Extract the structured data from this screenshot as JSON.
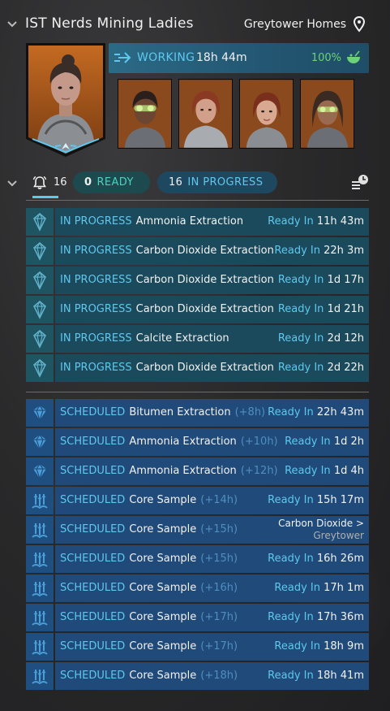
{
  "header": {
    "crew_name": "IST Nerds Mining Ladies",
    "location": "Greytower Homes"
  },
  "status": {
    "state": "WORKING",
    "time": "18h 44m",
    "food": "100%"
  },
  "filters": {
    "alerts": "16",
    "ready_count": "0",
    "ready_label": "READY",
    "progress_count": "16",
    "progress_label": "IN PROGRESS"
  },
  "in_progress": [
    {
      "status": "IN PROGRESS",
      "name": "Ammonia Extraction",
      "ready_label": "Ready In",
      "ready": "11h 43m"
    },
    {
      "status": "IN PROGRESS",
      "name": "Carbon Dioxide Extraction",
      "ready_label": "Ready In",
      "ready": "22h 3m"
    },
    {
      "status": "IN PROGRESS",
      "name": "Carbon Dioxide Extraction",
      "ready_label": "Ready In",
      "ready": "1d 17h"
    },
    {
      "status": "IN PROGRESS",
      "name": "Carbon Dioxide Extraction",
      "ready_label": "Ready In",
      "ready": "1d 21h"
    },
    {
      "status": "IN PROGRESS",
      "name": "Calcite Extraction",
      "ready_label": "Ready In",
      "ready": "2d 12h"
    },
    {
      "status": "IN PROGRESS",
      "name": "Carbon Dioxide Extraction",
      "ready_label": "Ready In",
      "ready": "2d 22h"
    }
  ],
  "scheduled": [
    {
      "status": "SCHEDULED",
      "name": "Bitumen Extraction",
      "offset": "(+8h)",
      "ready_label": "Ready In",
      "ready": "22h 43m",
      "icon": "diamond-icon"
    },
    {
      "status": "SCHEDULED",
      "name": "Ammonia Extraction",
      "offset": "(+10h)",
      "ready_label": "Ready In",
      "ready": "1d 2h",
      "icon": "diamond-icon"
    },
    {
      "status": "SCHEDULED",
      "name": "Ammonia Extraction",
      "offset": "(+12h)",
      "ready_label": "Ready In",
      "ready": "1d 4h",
      "icon": "diamond-icon"
    },
    {
      "status": "SCHEDULED",
      "name": "Core Sample",
      "offset": "(+14h)",
      "ready_label": "Ready In",
      "ready": "15h 17m",
      "icon": "core-sample-icon"
    },
    {
      "status": "SCHEDULED",
      "name": "Core Sample",
      "offset": "(+15h)",
      "dest_a": "Carbon Dioxide  >",
      "dest_b": "Greytower",
      "icon": "core-sample-icon"
    },
    {
      "status": "SCHEDULED",
      "name": "Core Sample",
      "offset": "(+15h)",
      "ready_label": "Ready In",
      "ready": "16h 26m",
      "icon": "core-sample-icon"
    },
    {
      "status": "SCHEDULED",
      "name": "Core Sample",
      "offset": "(+16h)",
      "ready_label": "Ready In",
      "ready": "17h 1m",
      "icon": "core-sample-icon"
    },
    {
      "status": "SCHEDULED",
      "name": "Core Sample",
      "offset": "(+17h)",
      "ready_label": "Ready In",
      "ready": "17h 36m",
      "icon": "core-sample-icon"
    },
    {
      "status": "SCHEDULED",
      "name": "Core Sample",
      "offset": "(+17h)",
      "ready_label": "Ready In",
      "ready": "18h 9m",
      "icon": "core-sample-icon"
    },
    {
      "status": "SCHEDULED",
      "name": "Core Sample",
      "offset": "(+18h)",
      "ready_label": "Ready In",
      "ready": "18h 41m",
      "icon": "core-sample-icon"
    }
  ]
}
